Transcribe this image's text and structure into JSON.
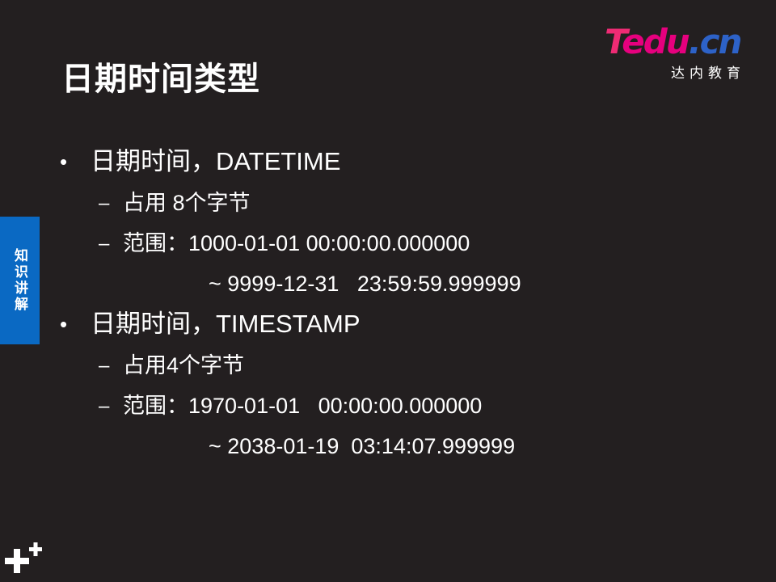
{
  "title": "日期时间类型",
  "logo": {
    "text_t": "T",
    "text_edu": "edu",
    "text_cn": ".cn",
    "subtitle": "达内教育",
    "colors": {
      "t": "#ee2b74",
      "edu": "#e6007e",
      "cn": "#2d62c8"
    }
  },
  "side_tab": {
    "label": "知识讲解",
    "color": "#0a69c3"
  },
  "bullet_symbol": "•",
  "dash_symbol": "–",
  "sections": [
    {
      "heading": "日期时间，DATETIME",
      "items": [
        "占用 8个字节",
        "范围：1000-01-01 00:00:00.000000",
        "~ 9999-12-31   23:59:59.999999"
      ]
    },
    {
      "heading": "日期时间，TIMESTAMP",
      "items": [
        "占用4个字节",
        "范围：1970-01-01   00:00:00.000000",
        "~ 2038-01-19  03:14:07.999999"
      ]
    }
  ],
  "colors": {
    "background": "#231f20",
    "text": "#ffffff"
  }
}
